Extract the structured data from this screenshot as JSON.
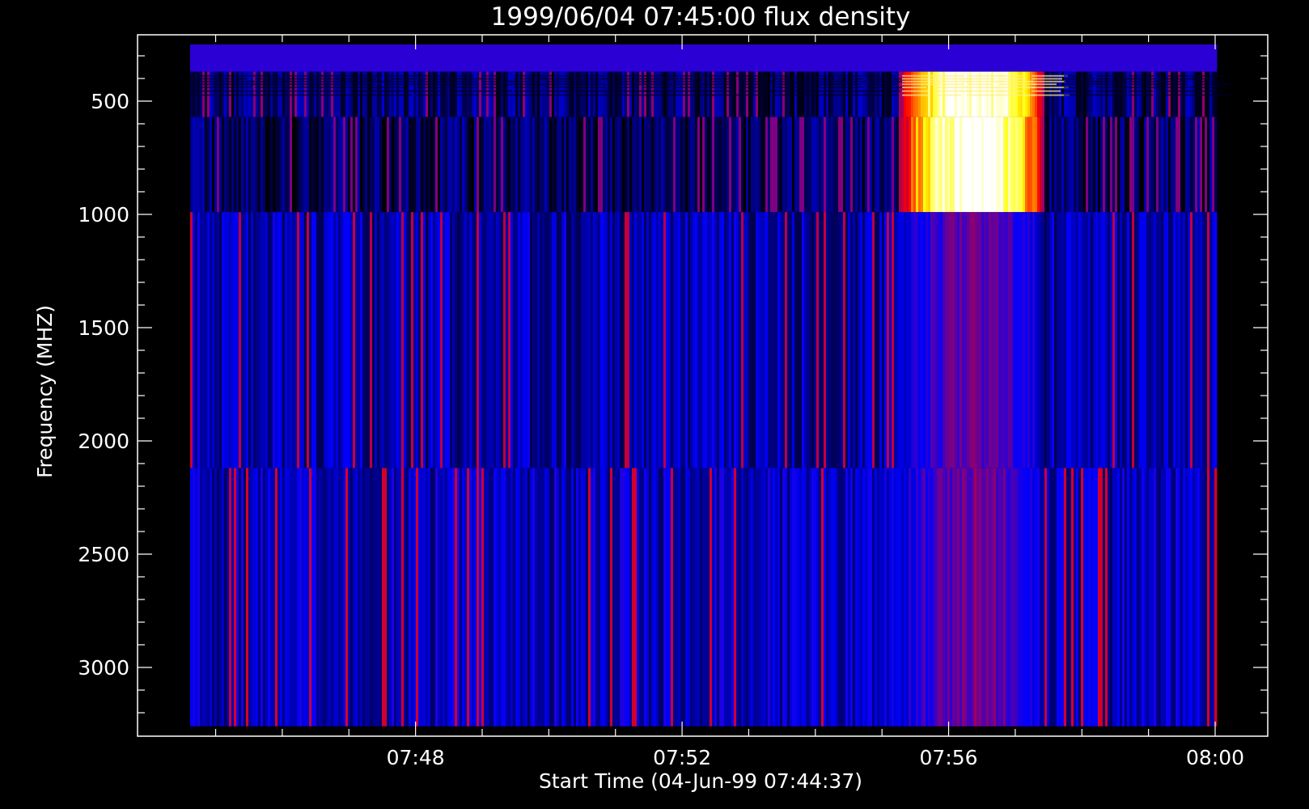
{
  "chart_data": {
    "type": "heatmap",
    "title": "1999/06/04 07:45:00 flux density",
    "xlabel": "Start Time (04-Jun-99 07:44:37)",
    "ylabel": "Frequency (MHZ)",
    "x_ticks": [
      "07:48",
      "07:52",
      "07:56",
      "08:00"
    ],
    "x_tick_minutes": [
      3.383,
      7.383,
      11.383,
      15.383
    ],
    "xlim_minutes": [
      0,
      15.383
    ],
    "y_ticks": [
      500,
      1000,
      1500,
      2000,
      2500,
      3000
    ],
    "ylim": [
      3300,
      250
    ],
    "y_inverted": true,
    "frequency_bands_mhz": [
      {
        "from": 250,
        "to": 370,
        "level": 0.15
      },
      {
        "from": 370,
        "to": 570,
        "level": 0.12
      },
      {
        "from": 570,
        "to": 990,
        "level": 0.1
      },
      {
        "from": 990,
        "to": 2120,
        "level": 0.18
      },
      {
        "from": 2120,
        "to": 3260,
        "level": 0.2
      }
    ],
    "burst": {
      "start_minute": 10.6,
      "peak_minute": 11.8,
      "end_minute": 12.8,
      "freq_from_mhz": 370,
      "freq_to_mhz": 990,
      "peak_level": 1.0,
      "weak_extension_to_mhz": 3260
    },
    "colormap": [
      "#000000",
      "#0000ff",
      "#ff0000",
      "#ffff00",
      "#ffffff"
    ]
  }
}
